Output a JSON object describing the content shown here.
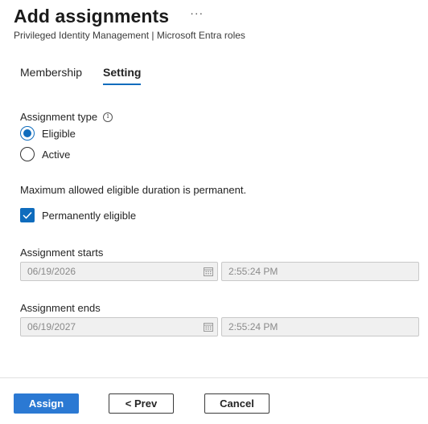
{
  "header": {
    "title": "Add assignments",
    "more_label": "···",
    "subtitle": "Privileged Identity Management | Microsoft Entra roles"
  },
  "tabs": [
    {
      "label": "Membership",
      "active": false
    },
    {
      "label": "Setting",
      "active": true
    }
  ],
  "assignment_type": {
    "label": "Assignment type",
    "info_icon": "info-icon",
    "options": [
      {
        "label": "Eligible",
        "checked": true
      },
      {
        "label": "Active",
        "checked": false
      }
    ]
  },
  "duration_note": "Maximum allowed eligible duration is permanent.",
  "permanently_eligible": {
    "label": "Permanently eligible",
    "checked": true
  },
  "assignment_starts": {
    "label": "Assignment starts",
    "date": "06/19/2026",
    "time": "2:55:24 PM"
  },
  "assignment_ends": {
    "label": "Assignment ends",
    "date": "06/19/2027",
    "time": "2:55:24 PM"
  },
  "footer": {
    "assign_label": "Assign",
    "prev_label": "< Prev",
    "cancel_label": "Cancel"
  },
  "colors": {
    "accent": "#0f6cbd",
    "primary_button": "#2b79d3",
    "disabled_input_bg": "#f0f0f0"
  }
}
